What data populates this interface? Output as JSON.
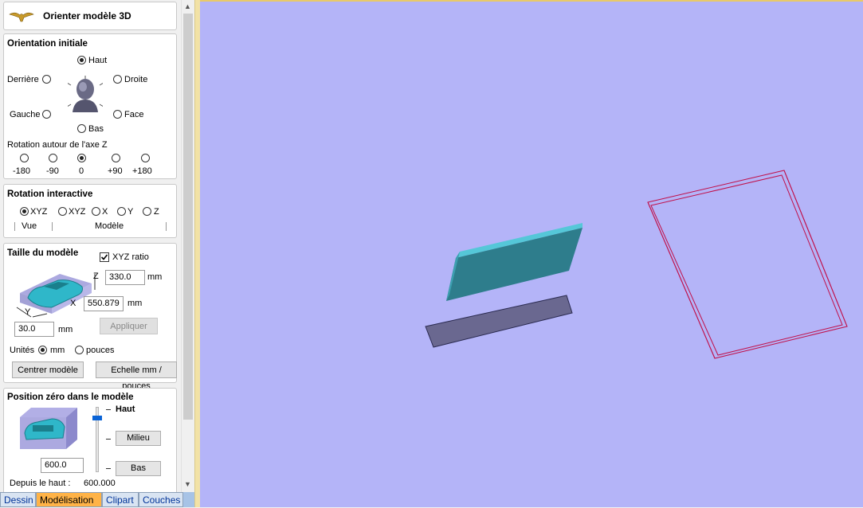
{
  "header": {
    "title": "Orienter modèle 3D"
  },
  "orientation": {
    "title": "Orientation initiale",
    "options": {
      "top": "Haut",
      "back": "Derrière",
      "right": "Droite",
      "left": "Gauche",
      "front": "Face",
      "bottom": "Bas"
    },
    "selected": "Haut",
    "rotation_label": "Rotation autour de l'axe Z",
    "rotation_options": [
      "-180",
      "-90",
      "0",
      "+90",
      "+180"
    ],
    "rotation_selected": "0"
  },
  "interactive": {
    "title": "Rotation interactive",
    "options": [
      "XYZ",
      "XYZ",
      "X",
      "Y",
      "Z"
    ],
    "selected_index": 0,
    "group_view": "Vue",
    "group_model": "Modèle"
  },
  "size": {
    "title": "Taille du modèle",
    "xyz_ratio_label": "XYZ ratio",
    "xyz_ratio_checked": true,
    "z_label": "Z",
    "z_value": "330.0",
    "x_label": "X",
    "x_value": "550.879",
    "y_label": "Y",
    "y_value": "30.0",
    "unit": "mm",
    "apply_label": "Appliquer",
    "units_label": "Unités",
    "unit_mm": "mm",
    "unit_inches": "pouces",
    "units_selected": "mm",
    "center_label": "Centrer modèle",
    "scale_label": "Echelle mm / pouces"
  },
  "zero": {
    "title": "Position zéro dans le modèle",
    "top_label": "Haut",
    "middle_label": "Milieu",
    "bottom_label": "Bas",
    "depth_value": "600.0",
    "from_top_label": "Depuis le haut :",
    "from_top_value": "600.000",
    "slider_level": 1.0
  },
  "tabs": [
    "Dessin",
    "Modélisation",
    "Clipart",
    "Couches"
  ],
  "active_tab": "Modélisation",
  "viewport": {
    "background": "#b4b4f8",
    "plate_color": "#2f7f8f",
    "outline_color": "#c0104a"
  }
}
